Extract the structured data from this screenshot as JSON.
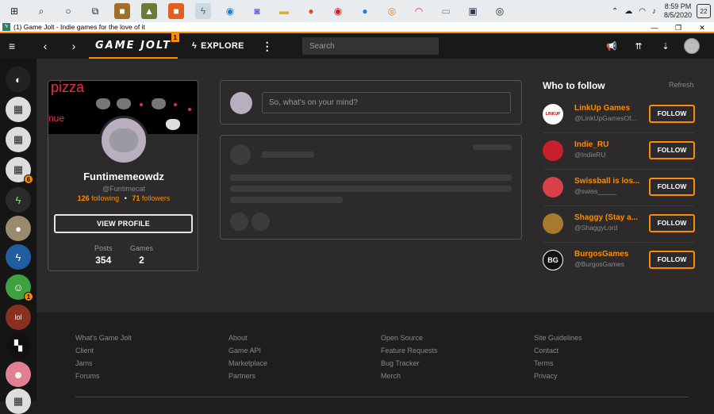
{
  "taskbar": {
    "icons": [
      "windows-start",
      "search",
      "cortana",
      "task-view",
      "app-steam-like",
      "app-minecraft",
      "app-orange",
      "app-gamejolt",
      "app-edge",
      "app-discord",
      "app-explorer",
      "app-firefox",
      "app-red",
      "app-b",
      "app-blender",
      "app-headphones",
      "app-files",
      "app-monitor",
      "app-record"
    ],
    "time": "8:59 PM",
    "date": "8/5/2020",
    "notif_count": "22"
  },
  "window": {
    "title": "(1) Game Jolt - Indie games for the love of it"
  },
  "header": {
    "logo": "GAME JOLT",
    "logo_badge": "1",
    "explore": "EXPLORE",
    "search_placeholder": "Search"
  },
  "sidebar": {
    "items": [
      {
        "badge": ""
      },
      {
        "badge": ""
      },
      {
        "badge": ""
      },
      {
        "badge": "6"
      },
      {
        "badge": ""
      },
      {
        "badge": ""
      },
      {
        "badge": ""
      },
      {
        "badge": "1"
      },
      {
        "badge": ""
      },
      {
        "badge": ""
      },
      {
        "badge": ""
      },
      {
        "badge": ""
      }
    ]
  },
  "profile": {
    "banner_text": "pizza",
    "banner_text2": "nue",
    "username": "Funtimemeowdz",
    "handle": "@Funtimecat",
    "following_count": "126",
    "following_label": "following",
    "followers_count": "71",
    "followers_label": "followers",
    "view_profile": "VIEW PROFILE",
    "posts_label": "Posts",
    "posts_value": "354",
    "games_label": "Games",
    "games_value": "2"
  },
  "post_box": {
    "placeholder": "So, what's on your mind?"
  },
  "who_to_follow": {
    "title": "Who to follow",
    "refresh": "Refresh",
    "follow_label": "FOLLOW",
    "users": [
      {
        "name": "LinkUp Games",
        "handle": "@LinkUpGamesOf...",
        "avatar_text": "LINKUP",
        "color": "#ffffff"
      },
      {
        "name": "Indie_RU",
        "handle": "@IndieRU",
        "avatar_text": "",
        "color": "#c8202a"
      },
      {
        "name": "Swissball is los...",
        "handle": "@swiss_____",
        "avatar_text": "",
        "color": "#d8404a"
      },
      {
        "name": "Shaggy (Stay a...",
        "handle": "@ShaggyLord",
        "avatar_text": "",
        "color": "#a87a30"
      },
      {
        "name": "BurgosGames",
        "handle": "@BurgosGames",
        "avatar_text": "BG",
        "color": "#111111"
      }
    ]
  },
  "footer": {
    "col1": [
      "What's Game Jolt",
      "Client",
      "Jams",
      "Forums"
    ],
    "col2": [
      "About",
      "Game API",
      "Marketplace",
      "Partners"
    ],
    "col3": [
      "Open Source",
      "Feature Requests",
      "Bug Tracker",
      "Merch"
    ],
    "col4": [
      "Site Guidelines",
      "Contact",
      "Terms",
      "Privacy"
    ]
  },
  "colors": {
    "accent": "#ff8c00",
    "background": "#2c2a2b",
    "header": "#191919"
  }
}
